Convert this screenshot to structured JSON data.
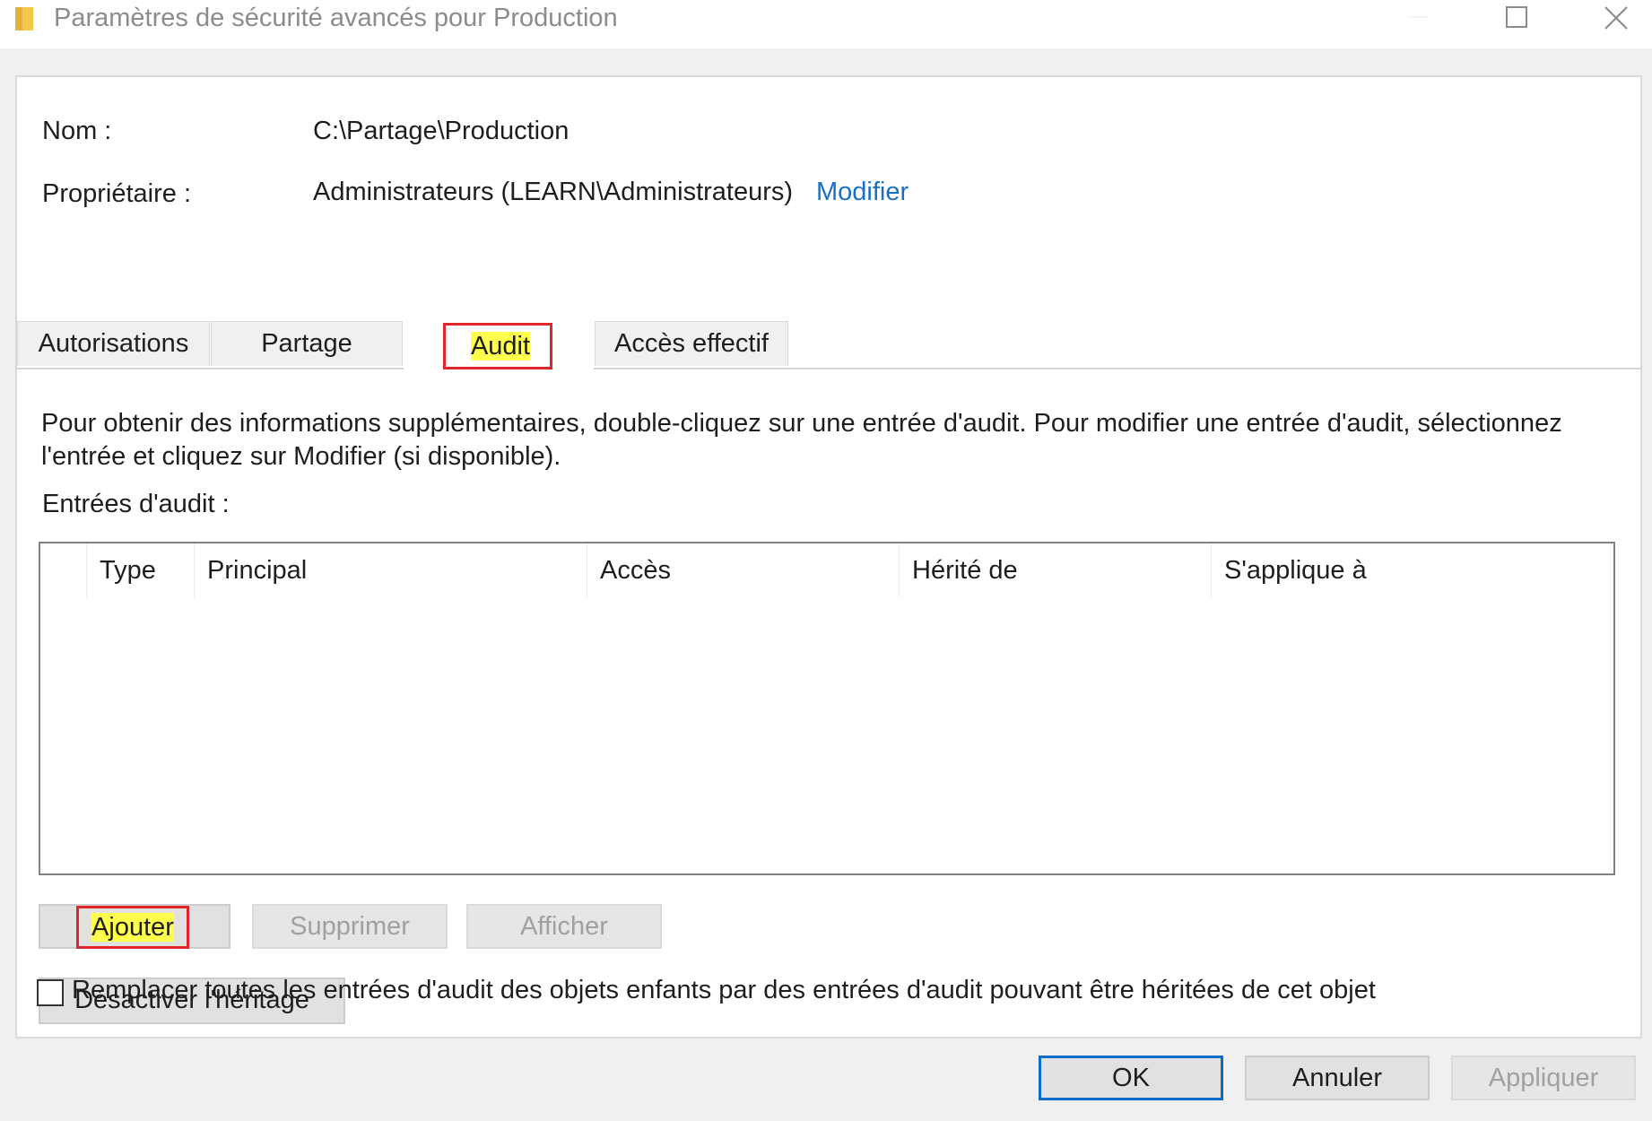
{
  "window": {
    "title": "Paramètres de sécurité avancés pour Production",
    "icon": "folder-icon"
  },
  "info": {
    "name_label": "Nom :",
    "name_value": "C:\\Partage\\Production",
    "owner_label": "Propriétaire :",
    "owner_value": "Administrateurs (LEARN\\Administrateurs)",
    "owner_change_link": "Modifier"
  },
  "tabs": [
    {
      "label": "Autorisations",
      "active": false
    },
    {
      "label": "Partage",
      "active": false
    },
    {
      "label": "Audit",
      "active": true
    },
    {
      "label": "Accès effectif",
      "active": false
    }
  ],
  "audit": {
    "description": "Pour obtenir des informations supplémentaires, double-cliquez sur une entrée d'audit. Pour modifier une entrée d'audit, sélectionnez l'entrée et cliquez sur Modifier (si disponible).",
    "entries_label": "Entrées d'audit :",
    "columns": [
      "Type",
      "Principal",
      "Accès",
      "Hérité de",
      "S'applique à"
    ],
    "rows": []
  },
  "list_buttons": {
    "add": "Ajouter",
    "remove": "Supprimer",
    "view": "Afficher"
  },
  "inheritance_button": "Désactiver l'héritage",
  "replace_checkbox": {
    "label": "Remplacer toutes les entrées d'audit des objets enfants par des entrées d'audit pouvant être héritées de cet objet",
    "checked": false
  },
  "dialog_buttons": {
    "ok": "OK",
    "cancel": "Annuler",
    "apply": "Appliquer"
  },
  "colors": {
    "highlight_border": "#e0262b",
    "highlight_fill": "#ffff4d",
    "link": "#1a6fc4",
    "default_button_border": "#0a6cc8"
  }
}
